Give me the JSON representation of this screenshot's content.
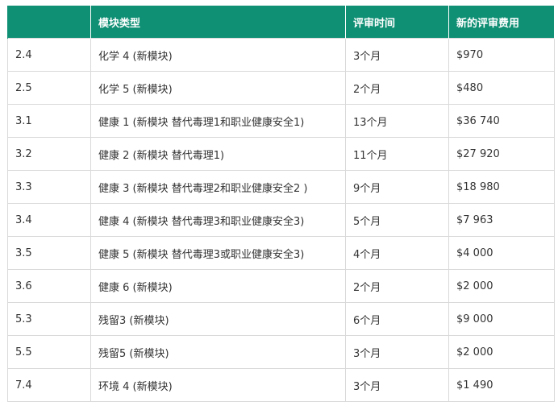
{
  "colors": {
    "header_bg": "#0f8f74",
    "header_text": "#ffffff",
    "border": "#d9d9d9"
  },
  "table": {
    "headers": [
      "",
      "模块类型",
      "评审时间",
      "新的评审费用"
    ],
    "rows": [
      [
        "2.4",
        "化学 4 (新模块)",
        "3个月",
        "$970"
      ],
      [
        "2.5",
        "化学 5 (新模块)",
        "2个月",
        "$480"
      ],
      [
        "3.1",
        "健康 1 (新模块 替代毒理1和职业健康安全1)",
        "13个月",
        "$36 740"
      ],
      [
        "3.2",
        "健康 2 (新模块 替代毒理1)",
        "11个月",
        "$27 920"
      ],
      [
        "3.3",
        "健康 3 (新模块 替代毒理2和职业健康安全2 )",
        "9个月",
        "$18 980"
      ],
      [
        "3.4",
        "健康 4 (新模块 替代毒理3和职业健康安全3)",
        "5个月",
        "$7 963"
      ],
      [
        "3.5",
        "健康 5 (新模块 替代毒理3或职业健康安全3)",
        "4个月",
        "$4 000"
      ],
      [
        "3.6",
        "健康 6 (新模块)",
        "2个月",
        "$2 000"
      ],
      [
        "5.3",
        "残留3 (新模块)",
        "6个月",
        "$9 000"
      ],
      [
        "5.5",
        "残留5 (新模块)",
        "3个月",
        "$2 000"
      ],
      [
        "7.4",
        "环境 4 (新模块)",
        "3个月",
        "$1 490"
      ]
    ]
  }
}
